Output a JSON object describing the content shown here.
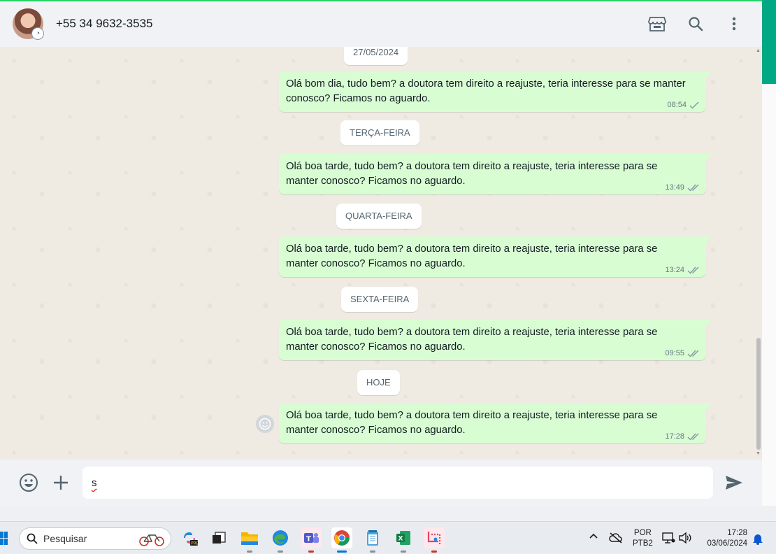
{
  "header": {
    "contact_name": "+55 34 9632-3535",
    "icons": [
      "avatar",
      "store-icon",
      "search-icon",
      "more-vertical-icon"
    ]
  },
  "chat": {
    "date_labels": [
      "27/05/2024",
      "TERÇA-FEIRA",
      "QUARTA-FEIRA",
      "SEXTA-FEIRA",
      "HOJE"
    ],
    "messages": [
      {
        "text": "Olá bom dia, tudo bem? a doutora tem direito a reajuste, teria interesse para se manter conosco? Ficamos no aguardo.",
        "time": "08:54",
        "status": "sent"
      },
      {
        "text": "Olá boa tarde, tudo bem? a doutora tem direito a reajuste, teria interesse para se manter conosco? Ficamos no aguardo.",
        "time": "13:49",
        "status": "delivered"
      },
      {
        "text": "Olá boa tarde, tudo bem? a doutora tem direito a reajuste, teria interesse para se manter conosco? Ficamos no aguardo.",
        "time": "13:24",
        "status": "delivered"
      },
      {
        "text": "Olá boa tarde, tudo bem? a doutora tem direito a reajuste, teria interesse para se manter conosco? Ficamos no aguardo.",
        "time": "09:55",
        "status": "delivered"
      },
      {
        "text": "Olá boa tarde, tudo bem? a doutora tem direito a reajuste, teria interesse para se manter conosco? Ficamos no aguardo.",
        "time": "17:28",
        "status": "delivered"
      }
    ]
  },
  "composer": {
    "value": "s",
    "icons": [
      "emoji-icon",
      "plus-icon",
      "send-icon"
    ]
  },
  "taskbar": {
    "search_label": "Pesquisar",
    "apps": [
      "copilot-icon",
      "task-view-icon",
      "file-explorer-icon",
      "edge-icon",
      "teams-icon",
      "chrome-icon",
      "notepad-icon",
      "excel-icon",
      "snipping-tool-icon"
    ],
    "language_line1": "POR",
    "language_line2": "PTB2",
    "time": "17:28",
    "date": "03/06/2024"
  },
  "colors": {
    "bubble_out": "#d9fdd3",
    "chat_bg": "#efeae2",
    "accent": "#00a884"
  }
}
